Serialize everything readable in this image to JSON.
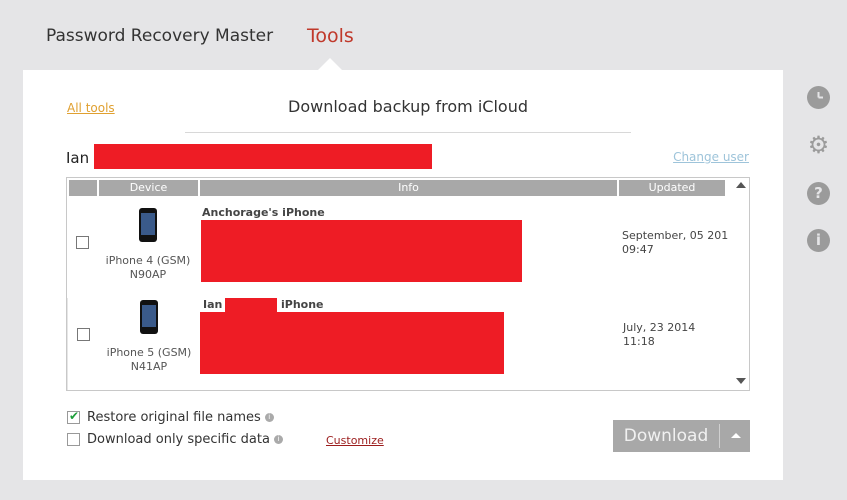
{
  "nav": {
    "inactive_tab": "Password Recovery Master",
    "active_tab": "Tools"
  },
  "panel": {
    "all_tools_link": "All tools",
    "title": "Download backup from iCloud",
    "user_name": "Ian",
    "change_user_link": "Change user"
  },
  "table": {
    "headers": [
      "",
      "Device",
      "Info",
      "Updated"
    ],
    "rows": [
      {
        "device_model": "iPhone 4 (GSM)",
        "device_code": "N90AP",
        "info_name": "Anchorage's iPhone",
        "updated_date": "September, 05 201",
        "updated_time": "09:47",
        "checked": false
      },
      {
        "device_model": "iPhone 5 (GSM)",
        "device_code": "N41AP",
        "info_name_prefix": "Ian",
        "info_name_suffix": "iPhone",
        "updated_date": "July, 23 2014",
        "updated_time": "11:18",
        "checked": false
      }
    ]
  },
  "options": {
    "restore_names_label": "Restore original file names",
    "restore_names_checked": true,
    "specific_data_label": "Download only specific data",
    "specific_data_checked": false,
    "customize_link": "Customize"
  },
  "download_button": {
    "label": "Download"
  },
  "colors": {
    "accent_red": "#c0392b",
    "redaction": "#ee1c25",
    "link_orange": "#e0a030",
    "link_blue": "#9ec4da",
    "button_gray": "#a8a8a8",
    "check_green": "#1e9e3a"
  },
  "side_icons": [
    "history-icon",
    "gear-icon",
    "help-icon",
    "info-icon"
  ]
}
